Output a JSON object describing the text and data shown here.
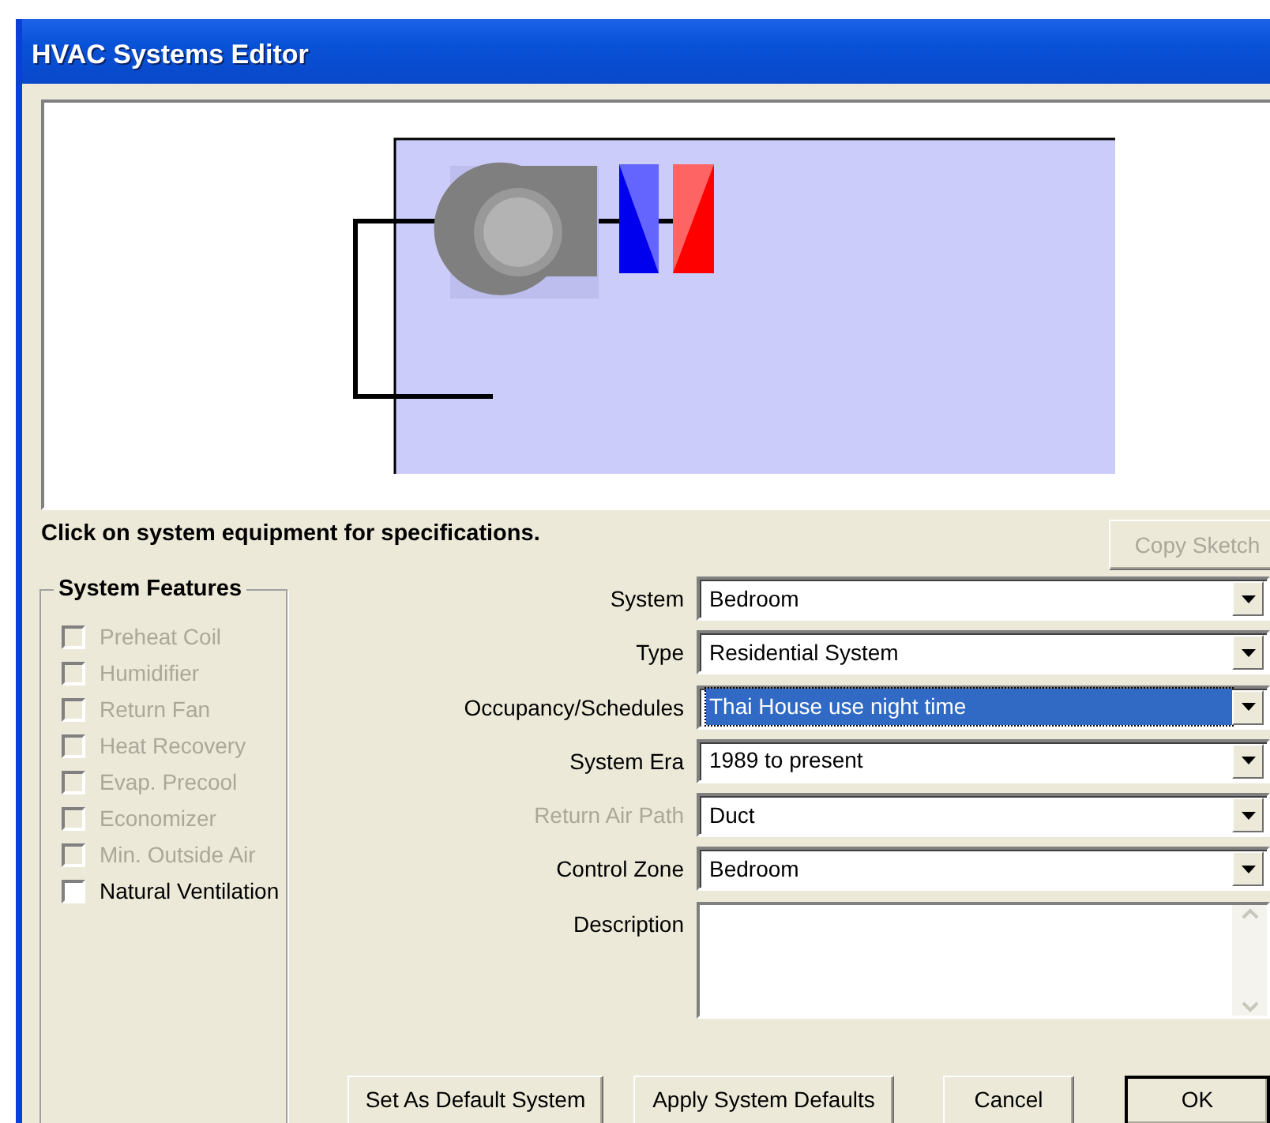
{
  "window": {
    "title": "HVAC Systems Editor"
  },
  "sketch": {
    "kind": "drawing"
  },
  "hint": "Click on system equipment for specifications.",
  "copy_sketch": {
    "label": "Copy Sketch",
    "disabled": true
  },
  "system_features": {
    "title": "System Features",
    "items": [
      {
        "label": "Preheat Coil",
        "checked": false,
        "disabled": true
      },
      {
        "label": "Humidifier",
        "checked": false,
        "disabled": true
      },
      {
        "label": "Return Fan",
        "checked": false,
        "disabled": true
      },
      {
        "label": "Heat Recovery",
        "checked": false,
        "disabled": true
      },
      {
        "label": "Evap. Precool",
        "checked": false,
        "disabled": true
      },
      {
        "label": "Economizer",
        "checked": false,
        "disabled": true
      },
      {
        "label": "Min. Outside Air",
        "checked": false,
        "disabled": true
      },
      {
        "label": "Natural Ventilation",
        "checked": false,
        "disabled": false
      }
    ]
  },
  "fields": [
    {
      "label": "System",
      "kind": "dropdown",
      "value": "Bedroom",
      "disabled": false,
      "focused": false
    },
    {
      "label": "Type",
      "kind": "dropdown",
      "value": "Residential System",
      "disabled": false,
      "focused": false
    },
    {
      "label": "Occupancy/Schedules",
      "kind": "dropdown",
      "value": "Thai House use night time",
      "disabled": false,
      "focused": true
    },
    {
      "label": "System Era",
      "kind": "dropdown",
      "value": "1989 to present",
      "disabled": false,
      "focused": false
    },
    {
      "label": "Return Air Path",
      "kind": "dropdown",
      "value": "Duct",
      "disabled": true,
      "focused": false
    },
    {
      "label": "Control Zone",
      "kind": "dropdown",
      "value": "Bedroom",
      "disabled": false,
      "focused": false
    },
    {
      "label": "Description",
      "kind": "textarea",
      "disabled": false,
      "focused": false
    }
  ],
  "buttons": [
    {
      "label": "Set As Default System",
      "default": false
    },
    {
      "label": "Apply System Defaults",
      "default": false
    },
    {
      "label": "Cancel",
      "default": false
    },
    {
      "label": "OK",
      "default": true
    }
  ]
}
